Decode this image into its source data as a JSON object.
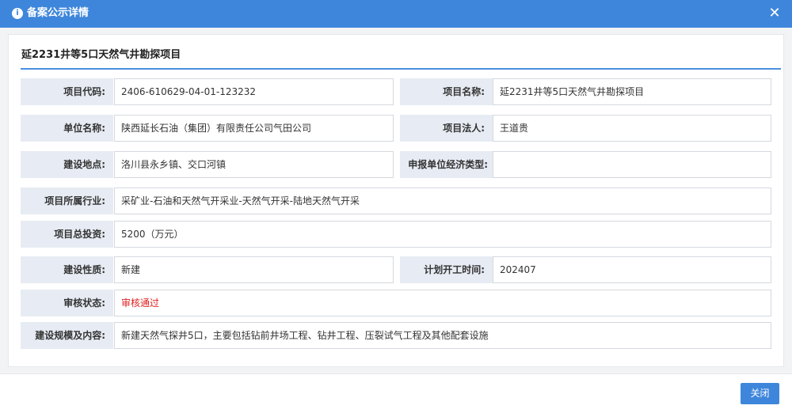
{
  "dialog": {
    "title": "备案公示详情",
    "info_icon": "i",
    "close_icon": "✕"
  },
  "project_title": "延2231井等5口天然气井勘探项目",
  "fields": {
    "project_code": {
      "label": "项目代码:",
      "value": "2406-610629-04-01-123232"
    },
    "project_name": {
      "label": "项目名称:",
      "value": "延2231井等5口天然气井勘探项目"
    },
    "unit_name": {
      "label": "单位名称:",
      "value": "陕西延长石油（集团）有限责任公司气田公司"
    },
    "legal_person": {
      "label": "项目法人:",
      "value": "王道贵"
    },
    "location": {
      "label": "建设地点:",
      "value": "洛川县永乡镇、交口河镇"
    },
    "economic_type": {
      "label": "申报单位经济类型:",
      "value": ""
    },
    "industry": {
      "label": "项目所属行业:",
      "value": "采矿业-石油和天然气开采业-天然气开采-陆地天然气开采"
    },
    "investment": {
      "label": "项目总投资:",
      "value": "5200（万元）"
    },
    "nature": {
      "label": "建设性质:",
      "value": "新建"
    },
    "start_time": {
      "label": "计划开工时间:",
      "value": "202407"
    },
    "review_status": {
      "label": "审核状态:",
      "value": "审核通过"
    },
    "scale": {
      "label": "建设规模及内容:",
      "value": "新建天然气探井5口，主要包括钻前井场工程、钻井工程、压裂试气工程及其他配套设施"
    }
  },
  "footer": {
    "close_label": "关闭"
  },
  "colors": {
    "accent": "#3e86db",
    "status_pass": "#e02020",
    "label_bg": "#e7ebf3"
  }
}
